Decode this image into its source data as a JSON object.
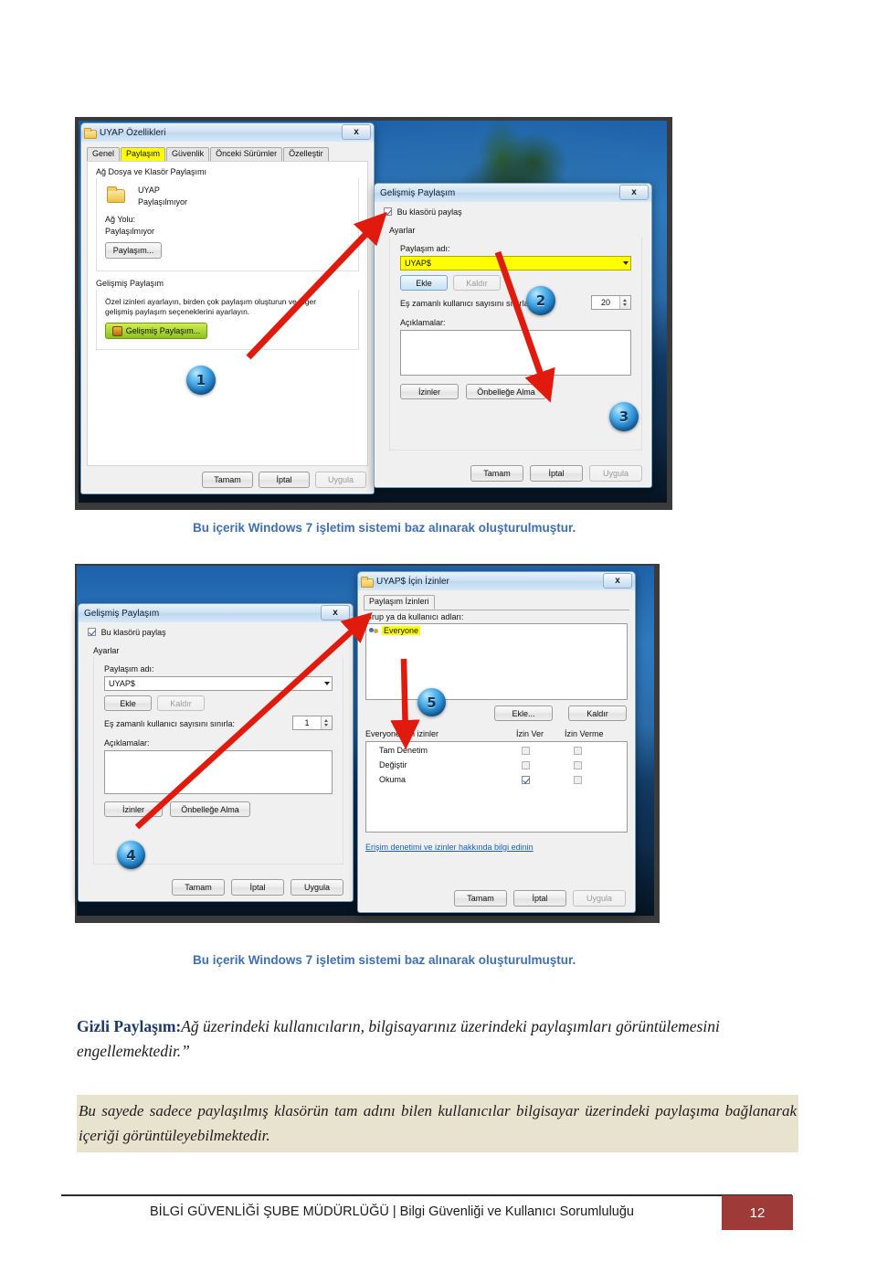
{
  "document": {
    "caption_1": "Bu içerik  Windows 7 işletim sistemi baz alınarak oluşturulmuştur.",
    "caption_2": "Bu içerik  Windows 7 işletim sistemi baz alınarak oluşturulmuştur.",
    "para_lead": "Gizli Paylaşım:",
    "para_body": "Ağ üzerindeki kullanıcıların, bilgisayarınız üzerindeki paylaşımları görüntülemesini engellemektedir.”",
    "highlight_para": "Bu sayede sadece paylaşılmış klasörün tam adını bilen kullanıcılar bilgisayar üzerindeki paylaşıma bağlanarak içeriği görüntüleyebilmektedir.",
    "footer_text": "BİLGİ GÜVENLİĞİ ŞUBE MÜDÜRLÜĞÜ | Bilgi Güvenliği ve Kullanıcı Sorumluluğu",
    "page_number": "12",
    "colors": {
      "caption": "#3f6fad",
      "lead": "#1f3864",
      "highlight_bg": "#e8e3cf",
      "page_box": "#9e3b38",
      "accent_yellow": "#ffff00",
      "arrow_red": "#e01b0e"
    }
  },
  "screenshot_1": {
    "properties_dialog": {
      "title": "UYAP Özellikleri",
      "close_label": "x",
      "tabs": [
        {
          "label": "Genel",
          "selected": false
        },
        {
          "label": "Paylaşım",
          "selected": true
        },
        {
          "label": "Güvenlik",
          "selected": false
        },
        {
          "label": "Önceki Sürümler",
          "selected": false
        },
        {
          "label": "Özelleştir",
          "selected": false
        }
      ],
      "group_share": {
        "legend": "Ağ Dosya ve Klasör Paylaşımı",
        "folder_name": "UYAP",
        "folder_state": "Paylaşılmıyor",
        "path_label": "Ağ Yolu:",
        "path_value": "Paylaşılmıyor",
        "share_button": "Paylaşım..."
      },
      "group_advanced": {
        "legend": "Gelişmiş Paylaşım",
        "description_line1": "Özel izinleri ayarlayın, birden çok paylaşım oluşturun ve diğer",
        "description_line2": "gelişmiş paylaşım seçeneklerini ayarlayın.",
        "button": "Gelişmiş Paylaşım..."
      },
      "footer_buttons": [
        {
          "label": "Tamam",
          "disabled": false
        },
        {
          "label": "İptal",
          "disabled": false
        },
        {
          "label": "Uygula",
          "disabled": true
        }
      ]
    },
    "advanced_share_dialog": {
      "title": "Gelişmiş Paylaşım",
      "close_label": "x",
      "share_checkbox_label": "Bu klasörü paylaş",
      "share_checkbox_checked": true,
      "settings_legend": "Ayarlar",
      "share_name_label": "Paylaşım adı:",
      "share_name_value": "UYAP$",
      "add_button": "Ekle",
      "remove_button": "Kaldır",
      "limit_label": "Eş zamanlı kullanıcı sayısını sınırla:",
      "limit_value": "20",
      "comments_label": "Açıklamalar:",
      "comments_value": "",
      "permissions_button": "İzinler",
      "caching_button": "Önbelleğe Alma",
      "footer_buttons": [
        {
          "label": "Tamam",
          "disabled": false
        },
        {
          "label": "İptal",
          "disabled": false
        },
        {
          "label": "Uygula",
          "disabled": true
        }
      ]
    },
    "badges": [
      "1",
      "2",
      "3"
    ]
  },
  "screenshot_2": {
    "advanced_share_dialog": {
      "title": "Gelişmiş Paylaşım",
      "close_label": "x",
      "share_checkbox_label": "Bu klasörü paylaş",
      "share_checkbox_checked": true,
      "settings_legend": "Ayarlar",
      "share_name_label": "Paylaşım adı:",
      "share_name_value": "UYAP$",
      "add_button": "Ekle",
      "remove_button": "Kaldır",
      "limit_label": "Eş zamanlı kullanıcı sayısını sınırla:",
      "limit_value": "1",
      "comments_label": "Açıklamalar:",
      "comments_value": "",
      "permissions_button": "İzinler",
      "caching_button": "Önbelleğe Alma",
      "footer_buttons": [
        {
          "label": "Tamam",
          "disabled": false
        },
        {
          "label": "İptal",
          "disabled": false
        },
        {
          "label": "Uygula",
          "disabled": false
        }
      ]
    },
    "permissions_dialog": {
      "title": "UYAP$ İçin İzinler",
      "close_label": "x",
      "tab_label": "Paylaşım İzinleri",
      "group_label": "Grup ya da kullanıcı adları:",
      "group_entry": "Everyone",
      "add_button": "Ekle...",
      "remove_button": "Kaldır",
      "perm_header": "Everyone için izinler",
      "col_allow": "İzin Ver",
      "col_deny": "İzin Verme",
      "rows": [
        {
          "name": "Tam Denetim",
          "allow": false,
          "deny": false
        },
        {
          "name": "Değiştir",
          "allow": false,
          "deny": false
        },
        {
          "name": "Okuma",
          "allow": true,
          "deny": false
        }
      ],
      "help_link": "Erişim denetimi ve izinler hakkında bilgi edinin",
      "footer_buttons": [
        {
          "label": "Tamam",
          "disabled": false
        },
        {
          "label": "İptal",
          "disabled": false
        },
        {
          "label": "Uygula",
          "disabled": true
        }
      ]
    },
    "badges": [
      "4",
      "5"
    ]
  }
}
